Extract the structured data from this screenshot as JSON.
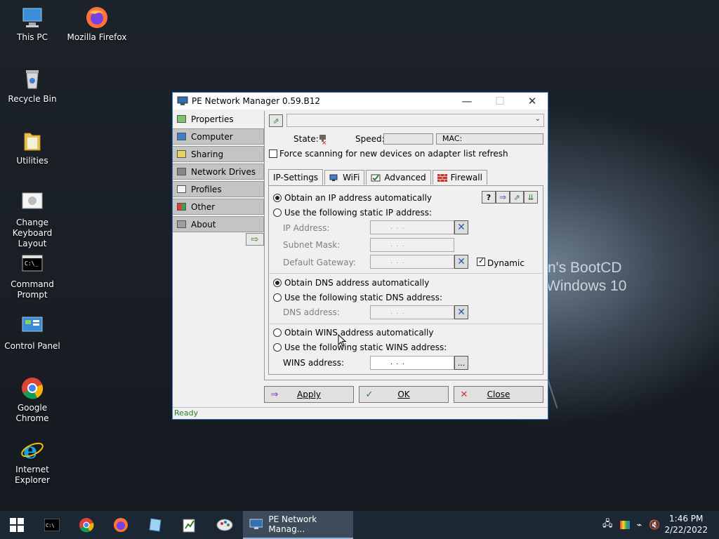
{
  "desktop": {
    "icons": [
      {
        "label": "This PC",
        "icon": "computer-icon"
      },
      {
        "label": "Mozilla Firefox",
        "icon": "firefox-icon"
      },
      {
        "label": "Recycle Bin",
        "icon": "recycle-bin-icon"
      },
      {
        "label": "Utilities",
        "icon": "folder-icon"
      },
      {
        "label": "Change Keyboard Layout",
        "icon": "keyboard-icon"
      },
      {
        "label": "Command Prompt",
        "icon": "cmd-icon"
      },
      {
        "label": "Control Panel",
        "icon": "control-panel-icon"
      },
      {
        "label": "Google Chrome",
        "icon": "chrome-icon"
      },
      {
        "label": "Internet Explorer",
        "icon": "ie-icon"
      }
    ],
    "wallpaper_text": [
      "n's BootCD",
      "Windows 10"
    ]
  },
  "window": {
    "title": "PE Network Manager 0.59.B12",
    "controls": {
      "minimize": "—",
      "maximize": "☐",
      "close": "✕"
    },
    "sidebar": {
      "items": [
        {
          "label": "Properties",
          "active": true
        },
        {
          "label": "Computer"
        },
        {
          "label": "Sharing"
        },
        {
          "label": "Network Drives"
        },
        {
          "label": "Profiles"
        },
        {
          "label": "Other"
        },
        {
          "label": "About"
        }
      ]
    },
    "adapter": {
      "selected": ""
    },
    "state_label": "State:",
    "speed_label": "Speed:",
    "mac_label": "MAC:",
    "force_scan": {
      "label": "Force scanning for new devices on adapter list refresh",
      "checked": false
    },
    "tabs": [
      {
        "label": "IP-Settings",
        "active": true
      },
      {
        "label": "WiFi"
      },
      {
        "label": "Advanced"
      },
      {
        "label": "Firewall"
      }
    ],
    "ip_settings": {
      "auto_ip": {
        "label": "Obtain an IP address automatically",
        "selected": true
      },
      "static_ip": {
        "label": "Use the following static IP address:",
        "selected": false
      },
      "ip_address_label": "IP Address:",
      "subnet_mask_label": "Subnet Mask:",
      "gateway_label": "Default Gateway:",
      "dynamic": {
        "label": "Dynamic",
        "checked": true
      },
      "auto_dns": {
        "label": "Obtain DNS address automatically",
        "selected": true
      },
      "static_dns": {
        "label": "Use the following static DNS address:",
        "selected": false
      },
      "dns_label": "DNS address:",
      "auto_wins": {
        "label": "Obtain WINS address automatically",
        "selected": false
      },
      "static_wins": {
        "label": "Use the following static WINS address:",
        "selected": false
      },
      "wins_label": "WINS address:",
      "ip_placeholder": ".       .       .",
      "browse_label": "..."
    },
    "buttons": {
      "apply": "Apply",
      "ok": "OK",
      "close": "Close"
    },
    "status": "Ready"
  },
  "taskbar": {
    "active_app": "PE Network Manag...",
    "clock_time": "1:46 PM",
    "clock_date": "2/22/2022"
  },
  "colors": {
    "accent": "#2f71c4",
    "taskbar": "#1b2733",
    "status_green": "#2e7d32"
  }
}
